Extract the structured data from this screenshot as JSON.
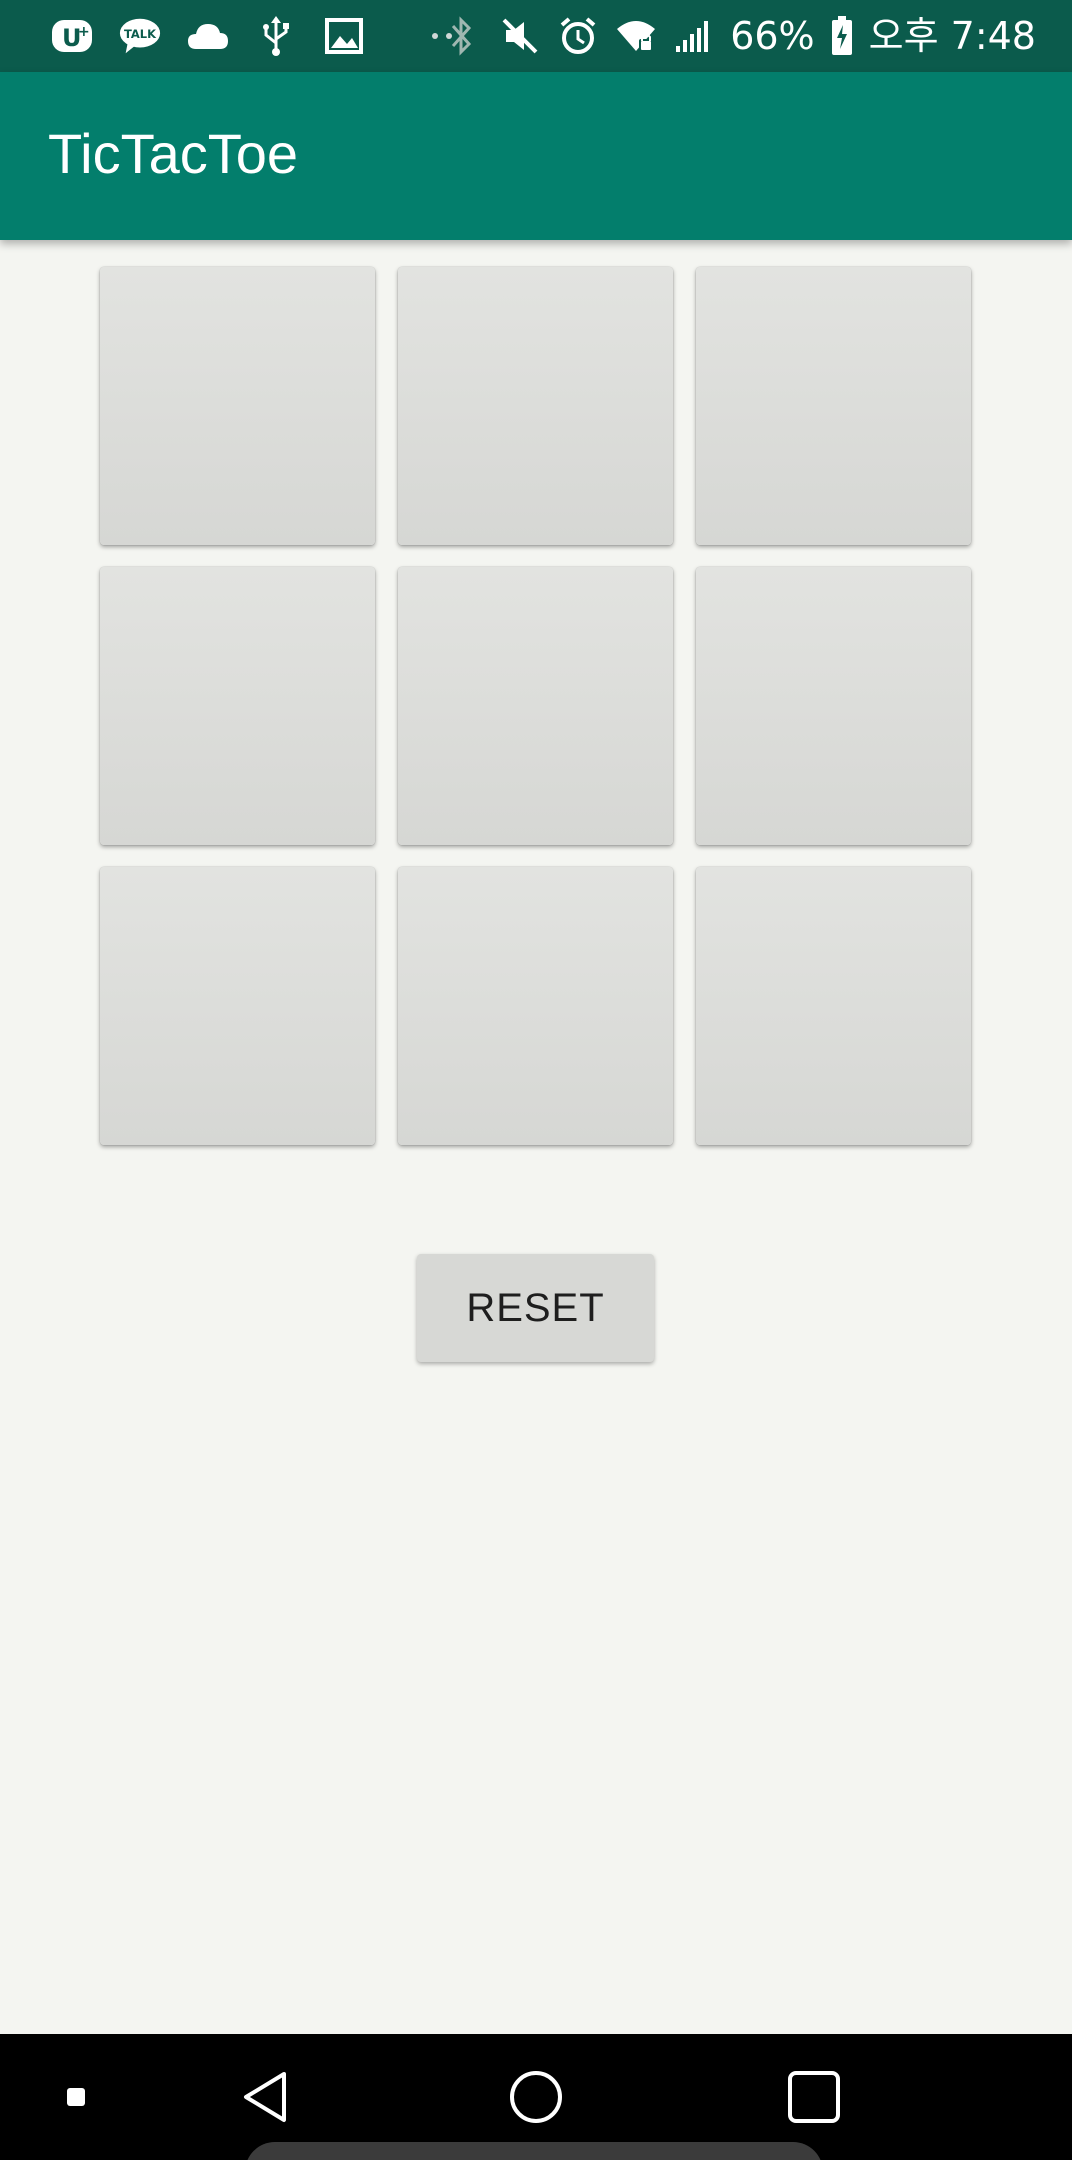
{
  "status_bar": {
    "icons_left": [
      "uplus-icon",
      "kakaotalk-icon",
      "cloud-icon",
      "usb-icon",
      "image-icon",
      "dots-icon"
    ],
    "talk_label": "TALK",
    "icons_right": [
      "bluetooth-icon",
      "mute-icon",
      "alarm-icon",
      "wifi-icon",
      "signal-icon",
      "battery-icon"
    ],
    "battery_percent": "66%",
    "time": "오후 7:48"
  },
  "app_bar": {
    "title": "TicTacToe",
    "color": "#037e6c"
  },
  "board": {
    "rows": [
      [
        "",
        "",
        ""
      ],
      [
        "",
        "",
        ""
      ],
      [
        "",
        "",
        ""
      ]
    ]
  },
  "reset_button": {
    "label": "RESET"
  },
  "nav_bar": {
    "items": [
      "recents-dot-icon",
      "back-icon",
      "home-icon",
      "overview-icon"
    ]
  },
  "colors": {
    "status_bar": "#0b5b4c",
    "background": "#f4f5f1",
    "cell": "#dcdcda"
  }
}
